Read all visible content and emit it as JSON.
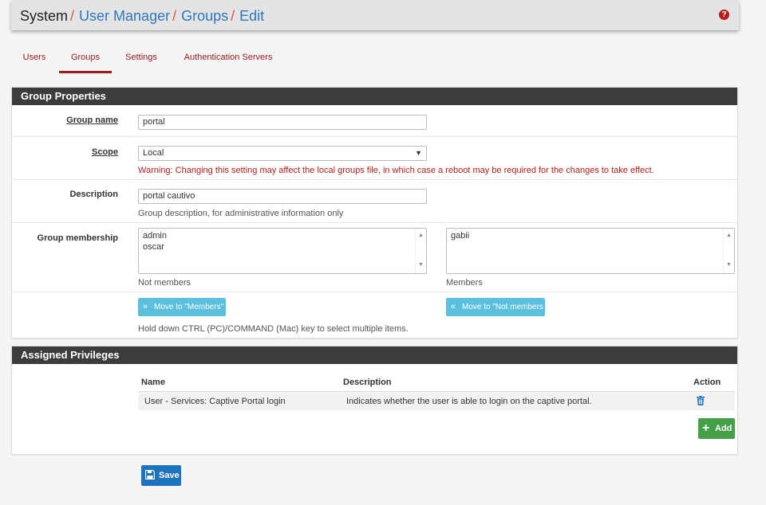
{
  "breadcrumb": {
    "root": "System",
    "items": [
      "User Manager",
      "Groups",
      "Edit"
    ],
    "separator": "/"
  },
  "help_icon": "?",
  "tabs": [
    {
      "label": "Users",
      "active": false
    },
    {
      "label": "Groups",
      "active": true
    },
    {
      "label": "Settings",
      "active": false
    },
    {
      "label": "Authentication Servers",
      "active": false
    }
  ],
  "group_properties": {
    "heading": "Group Properties",
    "group_name": {
      "label": "Group name",
      "value": "portal"
    },
    "scope": {
      "label": "Scope",
      "value": "Local",
      "warning": "Warning: Changing this setting may affect the local groups file, in which case a reboot may be required for the changes to take effect."
    },
    "description": {
      "label": "Description",
      "value": "portal cautivo",
      "help": "Group description, for administrative information only"
    },
    "membership": {
      "label": "Group membership",
      "not_members": [
        "admin",
        "oscar"
      ],
      "not_members_label": "Not members",
      "members": [
        "gabii"
      ],
      "members_label": "Members",
      "move_to_members_label": "Move to \"Members\"",
      "move_to_not_members_label": "Move to \"Not members",
      "help": "Hold down CTRL (PC)/COMMAND (Mac) key to select multiple items."
    }
  },
  "assigned_privileges": {
    "heading": "Assigned Privileges",
    "columns": [
      "Name",
      "Description",
      "Action"
    ],
    "rows": [
      {
        "name": "User - Services: Captive Portal login",
        "description": "Indicates whether the user is able to login on the captive portal."
      }
    ],
    "add_label": "Add"
  },
  "save_label": "Save",
  "colors": {
    "accent_red": "#9b1c1c",
    "link_blue": "#2e77bd",
    "panel_heading": "#3c3c3c",
    "info_button": "#5bc0de",
    "add_button": "#43a047",
    "save_button": "#1e73be"
  }
}
